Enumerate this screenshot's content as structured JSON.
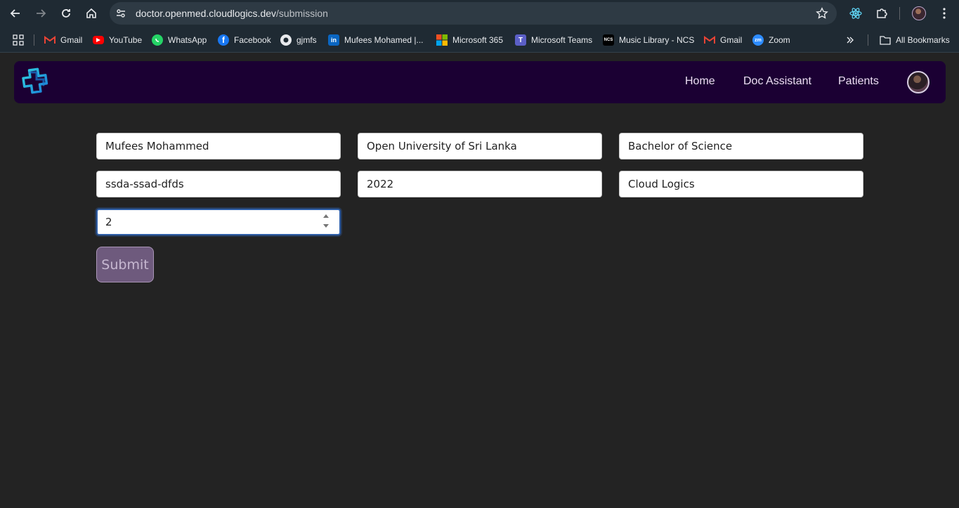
{
  "browser": {
    "url_host": "doctor.openmed.cloudlogics.dev",
    "url_path": "/submission",
    "bookmarks": [
      {
        "label": "Gmail",
        "icon": "gmail-icon"
      },
      {
        "label": "YouTube",
        "icon": "youtube-icon"
      },
      {
        "label": "WhatsApp",
        "icon": "whatsapp-icon"
      },
      {
        "label": "Facebook",
        "icon": "facebook-icon"
      },
      {
        "label": "gjmfs",
        "icon": "github-icon"
      },
      {
        "label": "Mufees Mohamed |...",
        "icon": "linkedin-icon"
      },
      {
        "label": "Microsoft 365",
        "icon": "microsoft-icon"
      },
      {
        "label": "Microsoft Teams",
        "icon": "teams-icon"
      },
      {
        "label": "Music Library - NCS",
        "icon": "ncs-icon"
      },
      {
        "label": "Gmail",
        "icon": "gmail-icon"
      },
      {
        "label": "Zoom",
        "icon": "zoom-icon"
      }
    ],
    "all_bookmarks": "All Bookmarks"
  },
  "navbar": {
    "links": [
      "Home",
      "Doc Assistant",
      "Patients"
    ]
  },
  "form": {
    "name": "Mufees Mohammed",
    "university": "Open University of Sri Lanka",
    "degree": "Bachelor of Science",
    "registration": "ssda-ssad-dfds",
    "year": "2022",
    "organization": "Cloud Logics",
    "count": "2",
    "submit_label": "Submit"
  },
  "colors": {
    "navbar_bg": "#1b0033",
    "page_bg": "#232323",
    "submit_bg": "#6e5a7d",
    "focus_border": "#2f5fa8"
  }
}
